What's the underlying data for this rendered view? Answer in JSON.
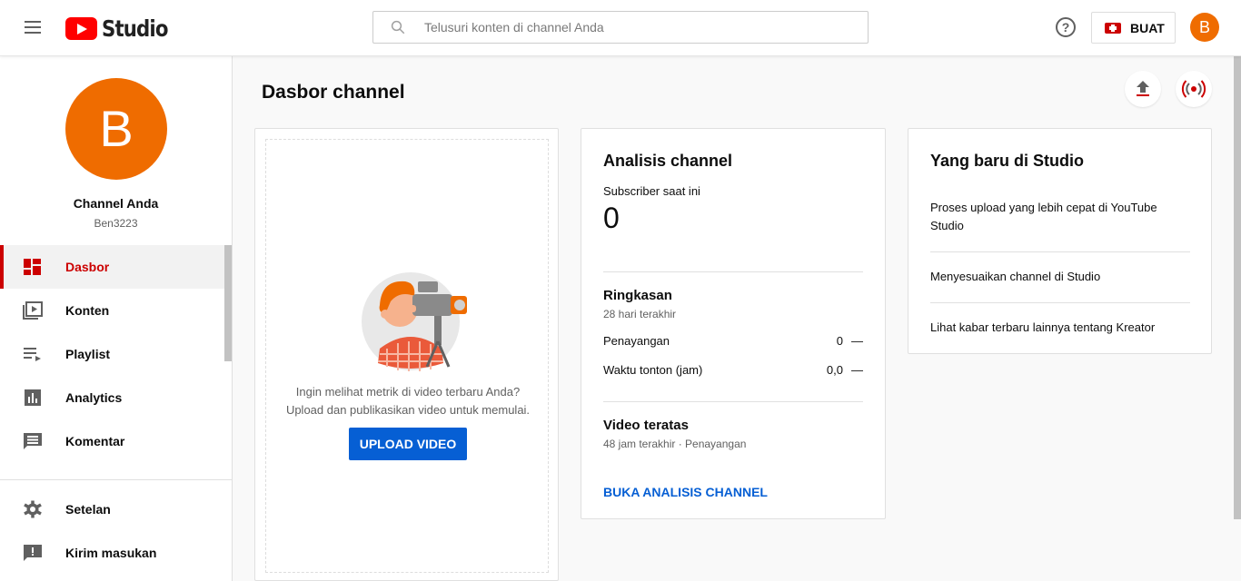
{
  "header": {
    "logo_text": "Studio",
    "search_placeholder": "Telusuri konten di channel Anda",
    "create_label": "BUAT",
    "avatar_letter": "B",
    "help_symbol": "?"
  },
  "sidebar": {
    "avatar_letter": "B",
    "channel_name": "Channel Anda",
    "channel_handle": "Ben3223",
    "items": [
      {
        "label": "Dasbor",
        "icon": "dashboard-icon",
        "active": true
      },
      {
        "label": "Konten",
        "icon": "content-icon",
        "active": false
      },
      {
        "label": "Playlist",
        "icon": "playlist-icon",
        "active": false
      },
      {
        "label": "Analytics",
        "icon": "analytics-icon",
        "active": false
      },
      {
        "label": "Komentar",
        "icon": "comments-icon",
        "active": false
      }
    ],
    "bottom_items": [
      {
        "label": "Setelan",
        "icon": "settings-icon"
      },
      {
        "label": "Kirim masukan",
        "icon": "feedback-icon"
      }
    ]
  },
  "main": {
    "title": "Dasbor channel",
    "upload_card": {
      "prompt_line1": "Ingin melihat metrik di video terbaru Anda?",
      "prompt_line2": "Upload dan publikasikan video untuk memulai.",
      "button_label": "UPLOAD VIDEO"
    },
    "analytics_card": {
      "title": "Analisis channel",
      "subscriber_label": "Subscriber saat ini",
      "subscriber_count": "0",
      "summary_title": "Ringkasan",
      "summary_period": "28 hari terakhir",
      "metrics": [
        {
          "label": "Penayangan",
          "value": "0",
          "trend": "—"
        },
        {
          "label": "Waktu tonton (jam)",
          "value": "0,0",
          "trend": "—"
        }
      ],
      "top_videos_title": "Video teratas",
      "top_videos_sub": "48 jam terakhir · Penayangan",
      "link_label": "BUKA ANALISIS CHANNEL"
    },
    "news_card": {
      "title": "Yang baru di Studio",
      "items": [
        "Proses upload yang lebih cepat di YouTube Studio",
        "Menyesuaikan channel di Studio",
        "Lihat kabar terbaru lainnya tentang Kreator"
      ]
    }
  },
  "colors": {
    "accent_red": "#cc0000",
    "avatar_orange": "#ef6c00",
    "link_blue": "#065fd4"
  }
}
